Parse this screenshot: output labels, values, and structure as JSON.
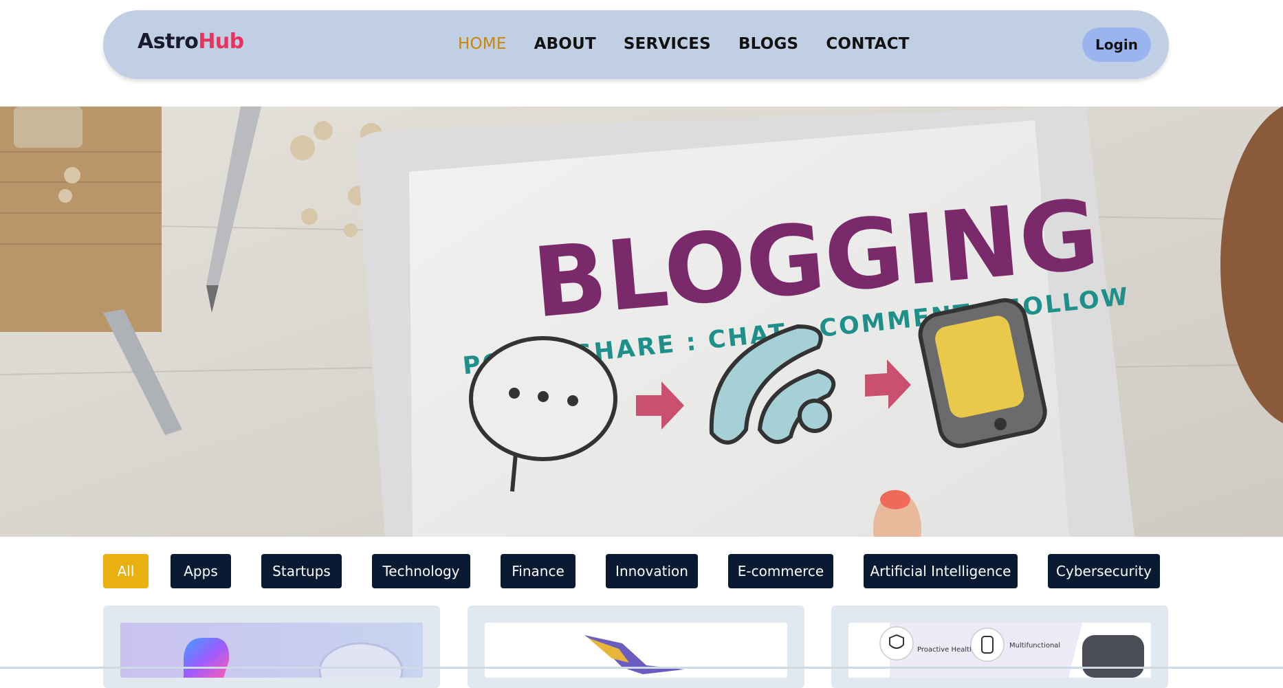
{
  "logo": {
    "part1": "Astro",
    "part2": "Hub"
  },
  "nav": {
    "items": [
      {
        "label": "HOME",
        "active": true
      },
      {
        "label": "ABOUT",
        "active": false
      },
      {
        "label": "SERVICES",
        "active": false
      },
      {
        "label": "BLOGS",
        "active": false
      },
      {
        "label": "CONTACT",
        "active": false
      }
    ],
    "login_label": "Login"
  },
  "hero": {
    "title": "BLOGGING",
    "tagline": "POST : SHARE : CHAT : COMMENT : FOLLOW"
  },
  "categories": [
    {
      "label": "All",
      "active": true
    },
    {
      "label": "Apps",
      "active": false
    },
    {
      "label": "Startups",
      "active": false
    },
    {
      "label": "Technology",
      "active": false
    },
    {
      "label": "Finance",
      "active": false
    },
    {
      "label": "Innovation",
      "active": false
    },
    {
      "label": "E-commerce",
      "active": false
    },
    {
      "label": "Artificial Intelligence",
      "active": false
    },
    {
      "label": "Cybersecurity",
      "active": false
    }
  ],
  "cards": [
    {
      "image": "copilot-logo-image"
    },
    {
      "image": "hummingbird-logo-image"
    },
    {
      "image": "smartwatch-image",
      "features": [
        "Proactive Healthcare",
        "Multifunctional"
      ]
    }
  ],
  "colors": {
    "navbar_bg": "#c0cfe3",
    "accent_active": "#c8860a",
    "logo_hub": "#e8335f",
    "login_bg": "#9ab4f0",
    "pill_bg": "#0a1a33",
    "pill_active": "#e8b10f",
    "hero_title": "#7a2a6a",
    "hero_tagline": "#1f8f8a"
  }
}
